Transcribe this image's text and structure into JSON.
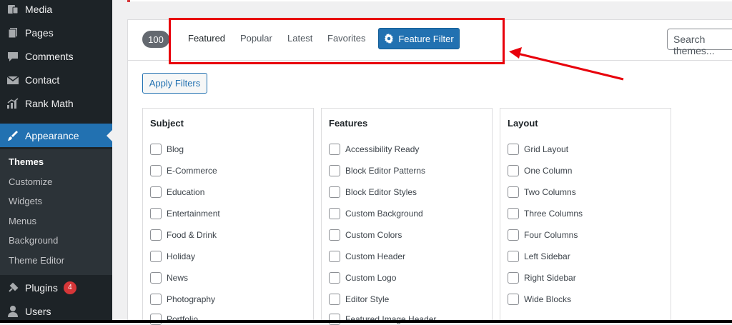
{
  "sidebar": {
    "items": [
      {
        "label": "Media",
        "icon": "media-icon"
      },
      {
        "label": "Pages",
        "icon": "pages-icon"
      },
      {
        "label": "Comments",
        "icon": "comments-icon"
      },
      {
        "label": "Contact",
        "icon": "contact-icon"
      },
      {
        "label": "Rank Math",
        "icon": "rank-math-icon"
      },
      {
        "label": "Appearance",
        "icon": "appearance-icon",
        "active": true
      },
      {
        "label": "Plugins",
        "icon": "plugins-icon",
        "badge": "4"
      },
      {
        "label": "Users",
        "icon": "users-icon"
      }
    ],
    "submenu": [
      "Themes",
      "Customize",
      "Widgets",
      "Menus",
      "Background",
      "Theme Editor"
    ]
  },
  "filter_bar": {
    "count": "100",
    "tabs": [
      "Featured",
      "Popular",
      "Latest",
      "Favorites"
    ],
    "feature_filter_label": "Feature Filter",
    "search_placeholder": "Search themes..."
  },
  "apply_filters_label": "Apply Filters",
  "groups": [
    {
      "title": "Subject",
      "options": [
        "Blog",
        "E-Commerce",
        "Education",
        "Entertainment",
        "Food & Drink",
        "Holiday",
        "News",
        "Photography",
        "Portfolio"
      ]
    },
    {
      "title": "Features",
      "options": [
        "Accessibility Ready",
        "Block Editor Patterns",
        "Block Editor Styles",
        "Custom Background",
        "Custom Colors",
        "Custom Header",
        "Custom Logo",
        "Editor Style",
        "Featured Image Header"
      ]
    },
    {
      "title": "Layout",
      "options": [
        "Grid Layout",
        "One Column",
        "Two Columns",
        "Three Columns",
        "Four Columns",
        "Left Sidebar",
        "Right Sidebar",
        "Wide Blocks"
      ]
    }
  ],
  "colors": {
    "accent": "#2271b1",
    "sidebar": "#1d2327",
    "highlight": "#e8000b",
    "badge": "#d63638"
  }
}
